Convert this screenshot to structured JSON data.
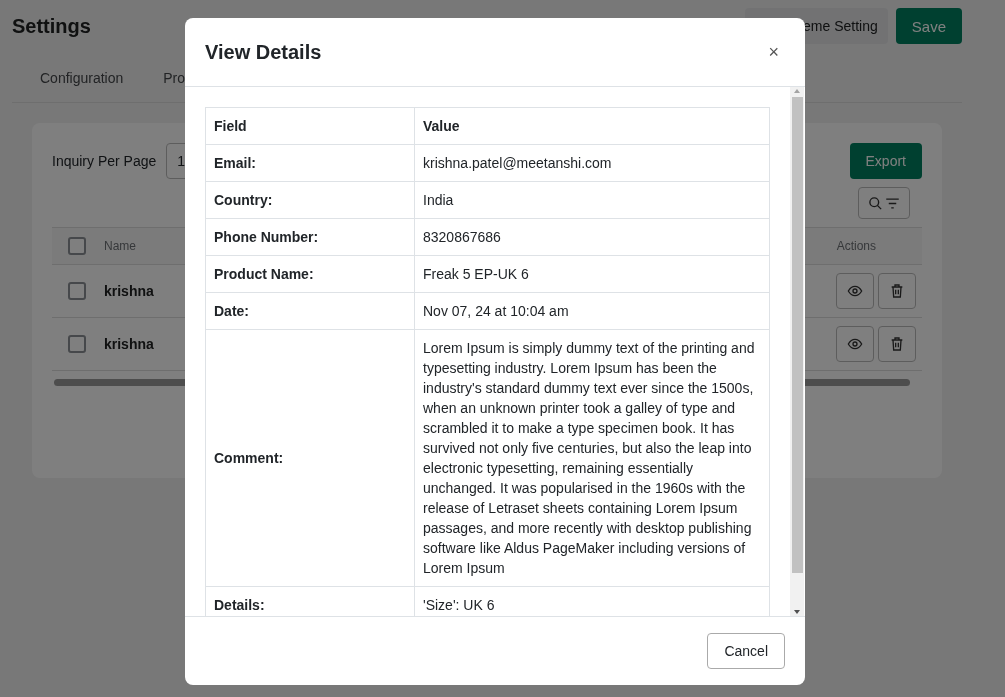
{
  "page": {
    "title": "Settings",
    "header_buttons": [
      {
        "label": "eme Setting",
        "kind": "secondary"
      },
      {
        "label": "Save",
        "kind": "primary"
      }
    ],
    "tabs": [
      {
        "label": "Configuration"
      },
      {
        "label": "Pro"
      }
    ],
    "card": {
      "per_page_label": "Inquiry Per Page",
      "per_page_value": "1",
      "export_button": "Export",
      "table": {
        "columns": [
          "Name",
          "Actions"
        ],
        "header_checked": false,
        "rows": [
          {
            "name": "krishna",
            "checked": false
          },
          {
            "name": "krishna",
            "checked": false
          }
        ]
      }
    }
  },
  "modal": {
    "title": "View Details",
    "close": "×",
    "table": {
      "columns": [
        "Field",
        "Value"
      ],
      "rows": [
        {
          "field": "Email:",
          "value": "krishna.patel@meetanshi.com"
        },
        {
          "field": "Country:",
          "value": "India"
        },
        {
          "field": "Phone Number:",
          "value": "8320867686"
        },
        {
          "field": "Product Name:",
          "value": "Freak 5 EP-UK 6"
        },
        {
          "field": "Date:",
          "value": "Nov 07, 24 at 10:04 am"
        },
        {
          "field": "Comment:",
          "value": "Lorem Ipsum is simply dummy text of the printing and typesetting industry. Lorem Ipsum has been the industry's standard dummy text ever since the 1500s, when an unknown printer took a galley of type and scrambled it to make a type specimen book. It has survived not only five centuries, but also the leap into electronic typesetting, remaining essentially unchanged. It was popularised in the 1960s with the release of Letraset sheets containing Lorem Ipsum passages, and more recently with desktop publishing software like Aldus PageMaker including versions of Lorem Ipsum"
        },
        {
          "field": "Details:",
          "value": "'Size': UK 6"
        }
      ]
    },
    "cancel": "Cancel"
  }
}
